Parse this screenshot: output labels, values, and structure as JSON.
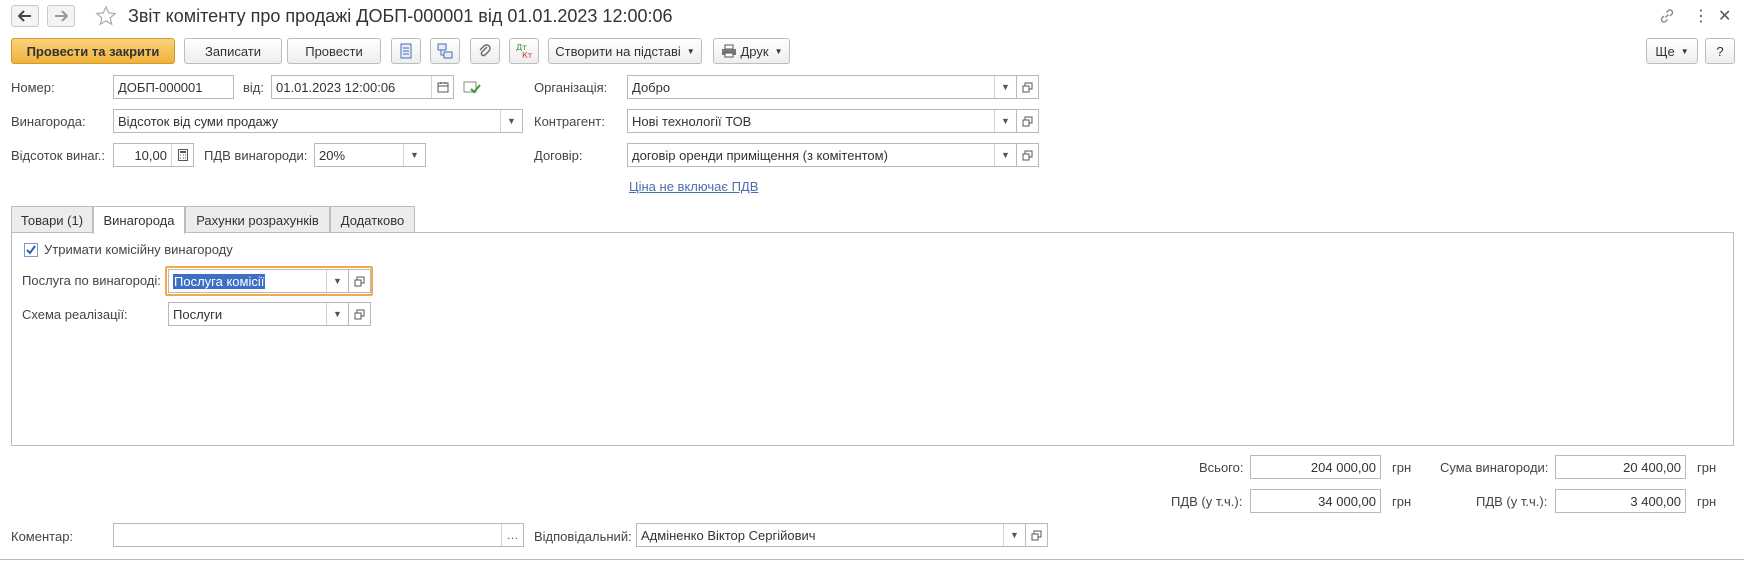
{
  "header": {
    "title": "Звіт комітенту про продажі ДОБП-000001 від 01.01.2023 12:00:06"
  },
  "toolbar": {
    "post_close": "Провести та закрити",
    "save": "Записати",
    "post": "Провести",
    "create_based": "Створити на підставі",
    "print": "Друк",
    "more": "Ще",
    "help": "?"
  },
  "form": {
    "number_label": "Номер:",
    "number": "ДОБП-000001",
    "date_label": "від:",
    "date": "01.01.2023 12:00:06",
    "org_label": "Організація:",
    "org": "Добро",
    "reward_label": "Винагорода:",
    "reward": "Відсоток від суми продажу",
    "counterparty_label": "Контрагент:",
    "counterparty": "Нові технології ТОВ",
    "percent_label": "Відсоток винаг.:",
    "percent": "10,00",
    "vat_reward_label": "ПДВ винагороди:",
    "vat_reward": "20%",
    "contract_label": "Договір:",
    "contract": "договір оренди приміщення (з комітентом)",
    "price_link": "Ціна не включає ПДВ"
  },
  "tabs": [
    {
      "label": "Товари (1)"
    },
    {
      "label": "Винагорода"
    },
    {
      "label": "Рахунки розрахунків"
    },
    {
      "label": "Додатково"
    }
  ],
  "reward_tab": {
    "withhold_label": "Утримати комісійну винагороду",
    "withhold_checked": true,
    "service_label": "Послуга по винагороді:",
    "service": "Послуга комісії",
    "scheme_label": "Схема реалізації:",
    "scheme": "Послуги"
  },
  "totals": {
    "total_label": "Всього:",
    "total": "204 000,00",
    "total_unit": "грн",
    "reward_sum_label": "Сума винагороди:",
    "reward_sum": "20 400,00",
    "reward_sum_unit": "грн",
    "vat_label": "ПДВ (у т.ч.):",
    "vat": "34 000,00",
    "vat_unit": "грн",
    "vat2_label": "ПДВ (у т.ч.):",
    "vat2": "3 400,00",
    "vat2_unit": "грн"
  },
  "footer": {
    "comment_label": "Коментар:",
    "comment": "",
    "responsible_label": "Відповідальний:",
    "responsible": "Адміненко Віктор Сергійович"
  }
}
